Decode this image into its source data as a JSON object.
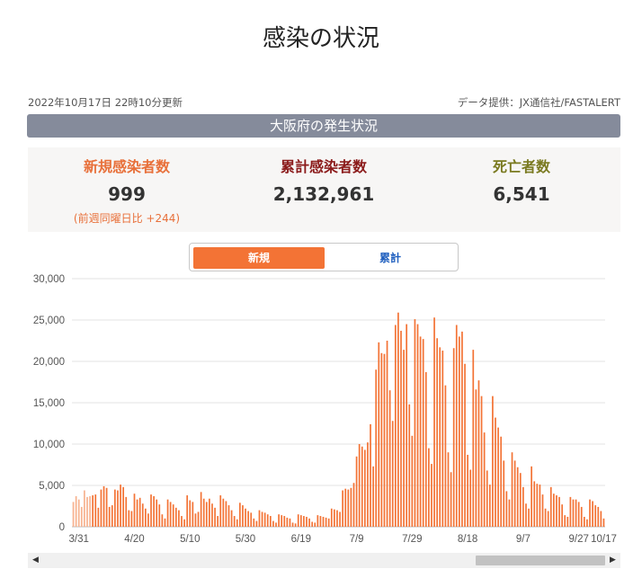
{
  "page": {
    "title": "感染の状況",
    "updated": "2022年10月17日 22時10分更新",
    "source": "データ提供：JX通信社/FASTALERT",
    "region_title": "大阪府の発生状況"
  },
  "stats": {
    "new_label": "新規感染者数",
    "new_value": "999",
    "new_sub": "(前週同曜日比 +244)",
    "total_label": "累計感染者数",
    "total_value": "2,132,961",
    "deaths_label": "死亡者数",
    "deaths_value": "6,541"
  },
  "toggle": {
    "new_label": "新規",
    "cumulative_label": "累計",
    "selected": "新規"
  },
  "colors": {
    "bar": "#f37335",
    "bar_faded": "#f7b28f",
    "header_bar": "#858b9b",
    "new_accent": "#e8703a",
    "total_accent": "#8b1a1a",
    "deaths_accent": "#7a7a20",
    "toggle_active": "#f37335",
    "toggle_inactive_text": "#1f5fbf"
  },
  "chart_data": {
    "type": "bar",
    "title": "",
    "xlabel": "",
    "ylabel": "",
    "ylim": [
      0,
      30000
    ],
    "yticks": [
      "0",
      "5,000",
      "10,000",
      "15,000",
      "20,000",
      "25,000",
      "30,000"
    ],
    "xticks": [
      "3/31",
      "4/20",
      "5/10",
      "5/30",
      "6/19",
      "7/9",
      "7/29",
      "8/18",
      "9/7",
      "9/27",
      "10/17"
    ],
    "grid": true,
    "faded_leading_bars": 7,
    "values": [
      3000,
      3700,
      3300,
      2400,
      4400,
      3600,
      3700,
      3800,
      3900,
      2300,
      4500,
      4900,
      4700,
      2400,
      2600,
      4500,
      4400,
      5100,
      4800,
      3600,
      2000,
      1900,
      4000,
      3300,
      3500,
      2800,
      2200,
      1600,
      3900,
      3700,
      3300,
      2700,
      1500,
      1000,
      3300,
      3000,
      2700,
      2300,
      2000,
      1300,
      900,
      3800,
      3200,
      3000,
      1600,
      1800,
      4200,
      3400,
      3000,
      3400,
      2800,
      2300,
      1300,
      3800,
      3400,
      3100,
      2600,
      2000,
      1300,
      900,
      2900,
      2600,
      2200,
      1900,
      1700,
      1000,
      700,
      2000,
      1800,
      1700,
      1500,
      1300,
      700,
      500,
      1500,
      1400,
      1300,
      1100,
      1000,
      500,
      400,
      1500,
      1400,
      1300,
      1200,
      1000,
      600,
      500,
      1400,
      1300,
      1200,
      1100,
      1000,
      2200,
      2100,
      2000,
      1800,
      4400,
      4600,
      4500,
      4700,
      5300,
      8500,
      10000,
      9700,
      9300,
      10200,
      12400,
      7300,
      19000,
      22300,
      21000,
      20900,
      22500,
      16500,
      12800,
      24400,
      25900,
      23700,
      21400,
      24500,
      14800,
      11000,
      25100,
      24500,
      23000,
      22700,
      18700,
      9500,
      7600,
      25300,
      22800,
      21700,
      21300,
      17100,
      9000,
      6600,
      21600,
      24400,
      23000,
      23600,
      19700,
      8700,
      6900,
      21400,
      16600,
      17700,
      15800,
      11400,
      6800,
      5100,
      15800,
      13200,
      12000,
      10900,
      8000,
      4300,
      3300,
      9000,
      8000,
      7200,
      6500,
      4800,
      2800,
      2200,
      7300,
      5500,
      5200,
      5100,
      3900,
      2200,
      1900,
      4800,
      4000,
      3800,
      3600,
      2700,
      1400,
      1200,
      3600,
      3300,
      3300,
      3000,
      2400,
      1200,
      900,
      3300,
      3100,
      2600,
      2400,
      1900,
      999
    ]
  }
}
